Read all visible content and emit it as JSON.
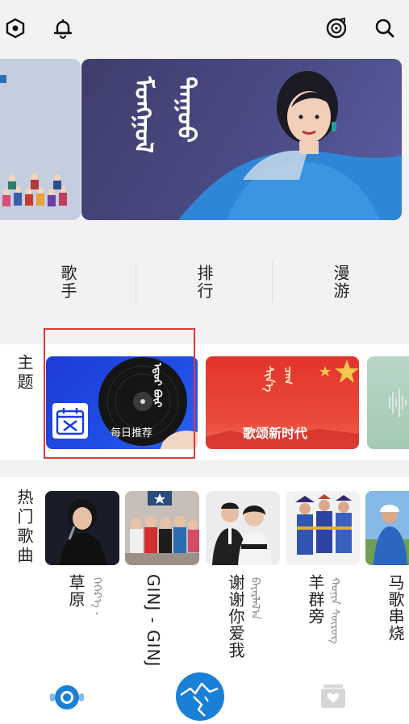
{
  "topbar": {
    "left_icons": [
      "hexagon-settings-icon",
      "bell-icon"
    ],
    "right_icons": [
      "music-disc-icon",
      "search-icon"
    ]
  },
  "banners": {
    "main_script": "ᠮᠣᠩᠭᠣᠯ ᠳᠠᠭᠤᠤ"
  },
  "nav": {
    "items": [
      {
        "label": "歌手"
      },
      {
        "label": "排行"
      },
      {
        "label": "漫游"
      }
    ]
  },
  "theme_section": {
    "title": "主题",
    "cards": [
      {
        "caption": "每日推荐",
        "script": "ᠡᠳᠦᠷ ᠪᠦᠷ",
        "icon": "calendar-icon"
      },
      {
        "caption": "歌颂新时代",
        "script": "ᠰᠢᠨ᠎ᠡ ᠴᠠᠭ"
      },
      {
        "caption": ""
      }
    ]
  },
  "hot_songs": {
    "title": "热门歌曲",
    "items": [
      {
        "title": "草原",
        "subtitle": "ᠬᠡᠭᠡᠷ᠎ᠡ - "
      },
      {
        "title": "GINJ - GINJ",
        "subtitle": ""
      },
      {
        "title": "谢谢你爱我",
        "subtitle": "ᠪᠠᠶᠠᠷᠯᠠᠯ᠎ᠠ"
      },
      {
        "title": "羊群旁",
        "subtitle": "ᠬᠣᠨᠢᠨ ᠰᠦᠷᠦᠭ"
      },
      {
        "title": "马歌串烧",
        "subtitle": ""
      }
    ]
  },
  "bottombar": {
    "icons": [
      "radio-icon",
      "home-mountain-icon",
      "collection-icon"
    ],
    "accent": "#1a7fd6"
  }
}
